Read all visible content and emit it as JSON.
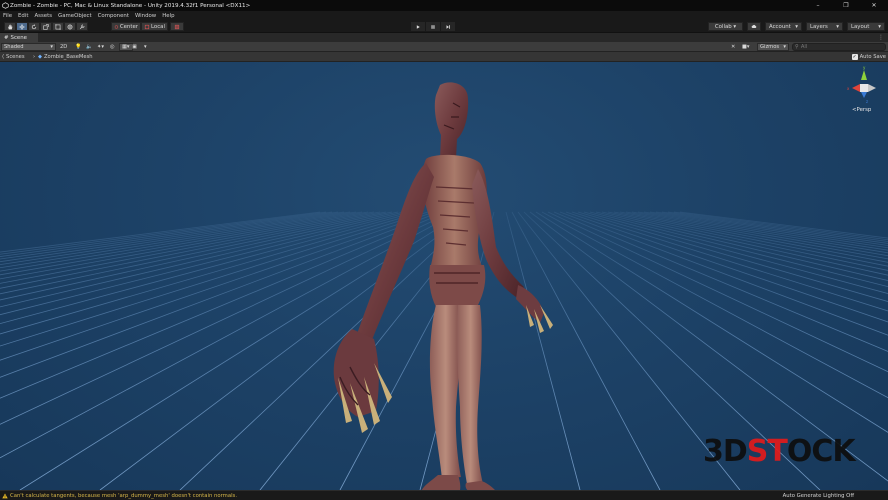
{
  "window": {
    "title": "Zombie - Zombie - PC, Mac & Linux Standalone - Unity 2019.4.32f1 Personal <DX11>",
    "controls": [
      "–",
      "❐",
      "✕"
    ]
  },
  "menu": [
    "File",
    "Edit",
    "Assets",
    "GameObject",
    "Component",
    "Window",
    "Help"
  ],
  "toolbar": {
    "tools": [
      "hand-tool",
      "move-tool",
      "rotate-tool",
      "scale-tool",
      "rect-tool",
      "transform-tool",
      "custom-tool"
    ],
    "pivot_label": "Center",
    "space_label": "Local",
    "collab_label": "Collab ▾",
    "account_label": "Account",
    "layers_label": "Layers",
    "layout_label": "Layout"
  },
  "scene_tab": {
    "label": "Scene"
  },
  "scene_toolbar": {
    "shading_mode": "Shaded",
    "mode_2d": "2D",
    "gizmos_label": "Gizmos",
    "search_placeholder": "All"
  },
  "breadcrumb": {
    "root": "Scenes",
    "prefab": "Zombie_BaseMesh",
    "auto_save_label": "Auto Save",
    "auto_save_checked": true
  },
  "viewport": {
    "projection_label": "<Persp",
    "gizmo_axes": {
      "x_color": "#e0443a",
      "y_color": "#8fd23b",
      "z_color": "#3a7bd5"
    }
  },
  "watermark": {
    "part1": "3D",
    "part2": "ST",
    "part3": "OCK"
  },
  "status": {
    "message": "Can't calculate tangents, because mesh 'arp_dummy_mesh' doesn't contain normals.",
    "right_text": "Auto Generate Lighting Off"
  }
}
